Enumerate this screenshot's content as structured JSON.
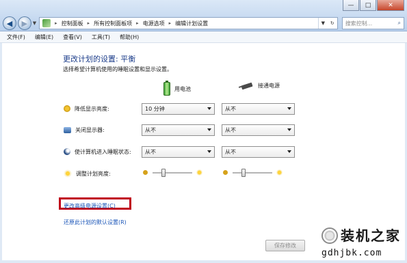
{
  "window": {
    "minimize": "—",
    "maximize": "□",
    "close": "✕"
  },
  "nav": {
    "back": "◀",
    "forward": "▶",
    "dropdown": "▼",
    "breadcrumbs": [
      "控制面板",
      "所有控制面板项",
      "电源选项",
      "编辑计划设置"
    ],
    "separator": "▸",
    "search_placeholder": "搜索控制...",
    "search_icon": "⌕",
    "refresh_icon": "↻"
  },
  "menu": [
    "文件(F)",
    "编辑(E)",
    "查看(V)",
    "工具(T)",
    "帮助(H)"
  ],
  "page": {
    "title": "更改计划的设置: 平衡",
    "description": "选择希望计算机使用的睡眠设置和显示设置。",
    "col_battery": "用电池",
    "col_plugged": "接通电源"
  },
  "settings": [
    {
      "label": "降低显示亮度:",
      "icon": "dim-icon",
      "battery": "10 分钟",
      "plugged": "从不"
    },
    {
      "label": "关闭显示器:",
      "icon": "monitor-icon",
      "battery": "从不",
      "plugged": "从不"
    },
    {
      "label": "使计算机进入睡眠状态:",
      "icon": "moon-icon",
      "battery": "从不",
      "plugged": "从不"
    }
  ],
  "brightness": {
    "label": "调整计划亮度:",
    "battery_level": 0.25,
    "plugged_level": 0.25
  },
  "links": {
    "advanced": "更改高级电源设置(C)",
    "restore": "还原此计划的默认设置(R)"
  },
  "buttons": {
    "save": "保存修改"
  },
  "watermark": {
    "title": "装机之家",
    "url": "gdhjbk.com"
  },
  "colors": {
    "link": "#1b56b8",
    "title": "#1c3d8a",
    "highlight": "#c0001a"
  }
}
